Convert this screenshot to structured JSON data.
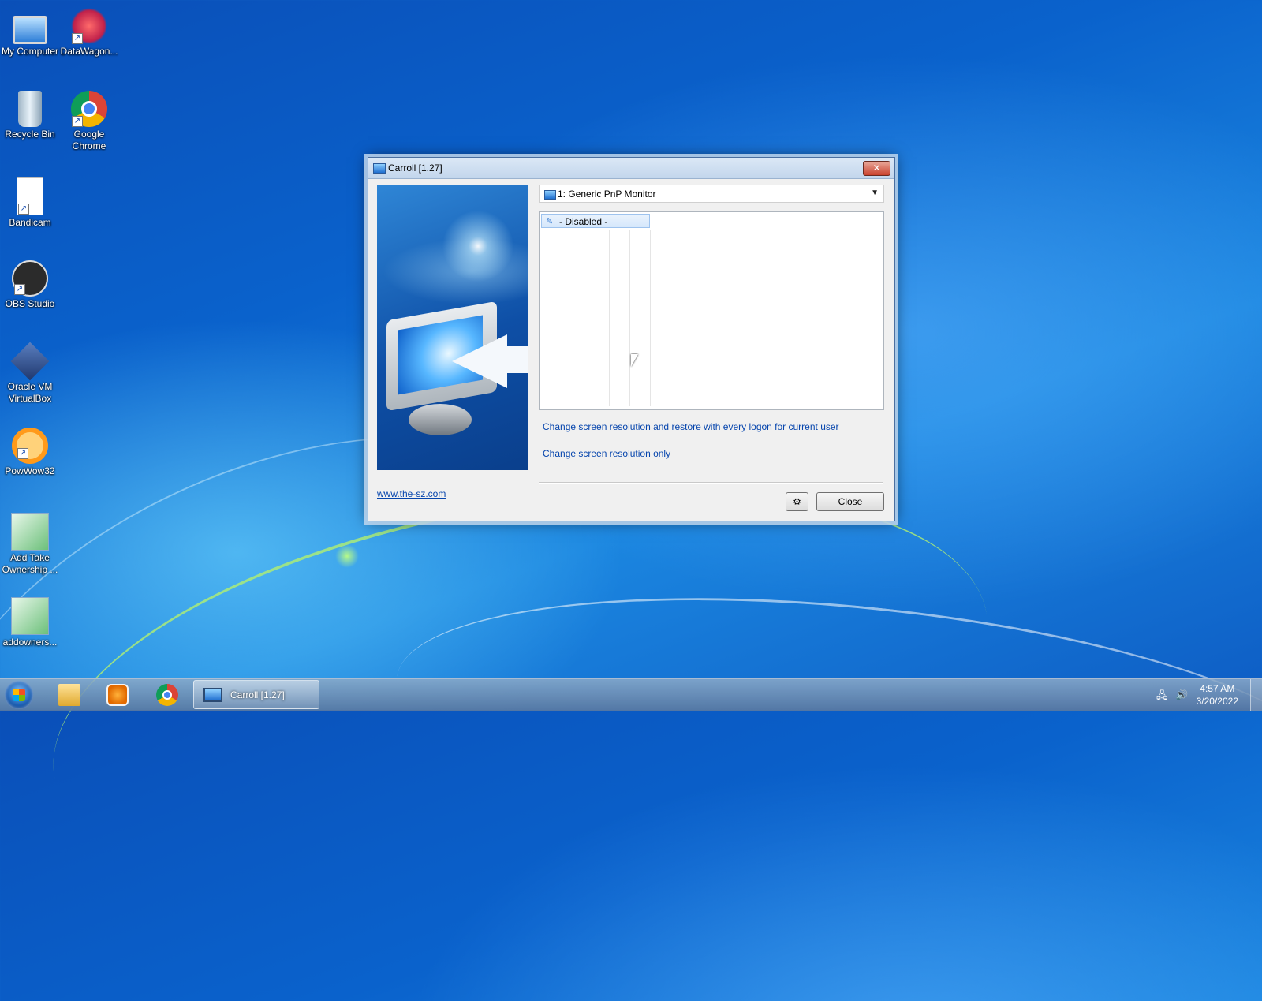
{
  "desktop": {
    "icons": [
      {
        "label": "My Computer",
        "icon": "computer-icon"
      },
      {
        "label": "DataWagon...",
        "icon": "datawagon-icon"
      },
      {
        "label": "Recycle Bin",
        "icon": "recycle-bin-icon"
      },
      {
        "label": "Google Chrome",
        "icon": "chrome-icon"
      },
      {
        "label": "Bandicam",
        "icon": "document-icon"
      },
      {
        "label": "OBS Studio",
        "icon": "obs-icon"
      },
      {
        "label": "Oracle VM VirtualBox",
        "icon": "virtualbox-icon"
      },
      {
        "label": "PowWow32",
        "icon": "spiral-icon"
      },
      {
        "label": "Add Take Ownership ...",
        "icon": "registry-icon"
      },
      {
        "label": "addowners...",
        "icon": "registry-icon"
      }
    ]
  },
  "window": {
    "title": "Carroll [1.27]",
    "close_glyph": "✕",
    "monitor_select": {
      "value": "1: Generic PnP Monitor"
    },
    "list": {
      "items": [
        {
          "label": "- Disabled -"
        }
      ]
    },
    "links": {
      "change_restore": "Change screen resolution and restore with every logon for current user",
      "change_only": "Change screen resolution only",
      "website": "www.the-sz.com"
    },
    "buttons": {
      "settings_glyph": "⚙",
      "close": "Close"
    }
  },
  "taskbar": {
    "active_task": "Carroll [1.27]",
    "clock": {
      "time": "4:57 AM",
      "date": "3/20/2022"
    }
  },
  "colors": {
    "link": "#0645ad",
    "desktop": "#0a62cc"
  }
}
